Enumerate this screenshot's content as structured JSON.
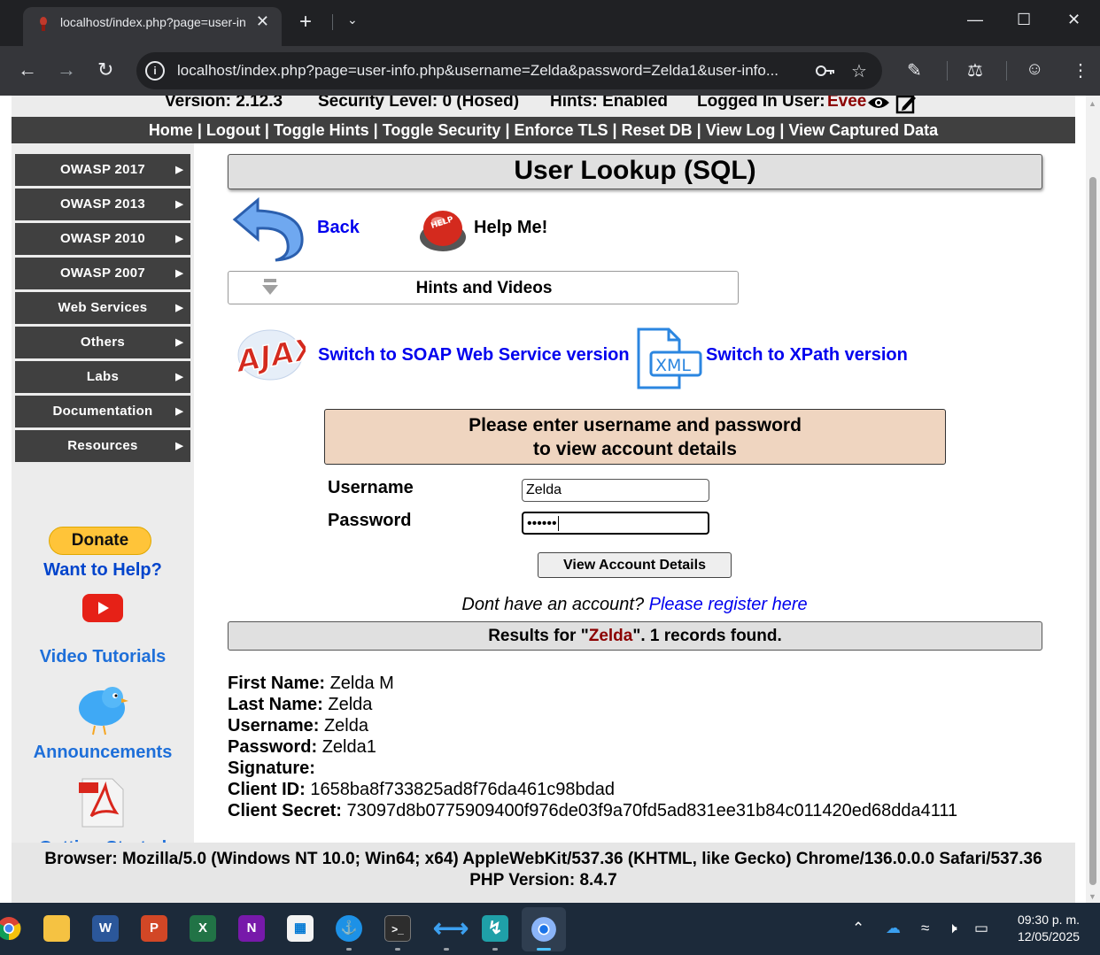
{
  "browser": {
    "tab_title": "localhost/index.php?page=user-info.php",
    "tab_close": "✕",
    "new_tab": "+",
    "url": "localhost/index.php?page=user-info.php&username=Zelda&password=Zelda1&user-info..."
  },
  "status_bar": {
    "version": "Version: 2.12.3",
    "security": "Security Level: 0 (Hosed)",
    "hints": "Hints: Enabled",
    "logged_in_label": "Logged In User:",
    "logged_in_user": "Evee"
  },
  "nav": {
    "home": "Home",
    "logout": "Logout",
    "toggle_hints": "Toggle Hints",
    "toggle_security": "Toggle Security",
    "enforce_tls": "Enforce TLS",
    "reset_db": "Reset DB",
    "view_log": "View Log",
    "view_captured": "View Captured Data",
    "sep": "|"
  },
  "sidebar": {
    "items": [
      {
        "label": "OWASP 2017"
      },
      {
        "label": "OWASP 2013"
      },
      {
        "label": "OWASP 2010"
      },
      {
        "label": "OWASP 2007"
      },
      {
        "label": "Web Services"
      },
      {
        "label": "Others"
      },
      {
        "label": "Labs"
      },
      {
        "label": "Documentation"
      },
      {
        "label": "Resources"
      }
    ],
    "donate": "Donate",
    "want_help": "Want to Help?",
    "video_tutorials": "Video Tutorials",
    "announcements": "Announcements",
    "getting_started": "Getting Started"
  },
  "main": {
    "title": "User Lookup (SQL)",
    "back": "Back",
    "help": "Help Me!",
    "hints_videos": "Hints and Videos",
    "switch_soap": "Switch to SOAP Web Service version",
    "switch_xpath": "Switch to XPath version",
    "form_header_line1": "Please enter username and password",
    "form_header_line2": "to view account details",
    "username_label": "Username",
    "password_label": "Password",
    "username_value": "Zelda",
    "password_value": "••••••",
    "view_button": "View Account Details",
    "no_account": "Dont have an account?",
    "register_link": "Please register here",
    "results_prefix": "Results for \"",
    "results_query": "Zelda",
    "results_suffix": "\". 1 records found."
  },
  "record": {
    "first_name_label": "First Name:",
    "first_name": "Zelda M",
    "last_name_label": "Last Name:",
    "last_name": "Zelda",
    "username_label": "Username:",
    "username": "Zelda",
    "password_label": "Password:",
    "password": "Zelda1",
    "signature_label": "Signature:",
    "signature": "",
    "client_id_label": "Client ID:",
    "client_id": "1658ba8f733825ad8f76da461c98bdad",
    "client_secret_label": "Client Secret:",
    "client_secret": "73097d8b0775909400f976de03f9a70fd5ad831ee31b84c011420ed68dda4111"
  },
  "footer": {
    "browser_line": "Browser: Mozilla/5.0 (Windows NT 10.0; Win64; x64) AppleWebKit/537.36 (KHTML, like Gecko) Chrome/136.0.0.0 Safari/537.36",
    "php_line": "PHP Version: 8.4.7"
  },
  "taskbar": {
    "time": "09:30 p. m.",
    "date": "12/05/2025"
  },
  "colors": {
    "nav_bg": "#404040",
    "link_blue": "#0000ee",
    "user_red": "#8b0000",
    "form_header_bg": "#efd5c0"
  }
}
